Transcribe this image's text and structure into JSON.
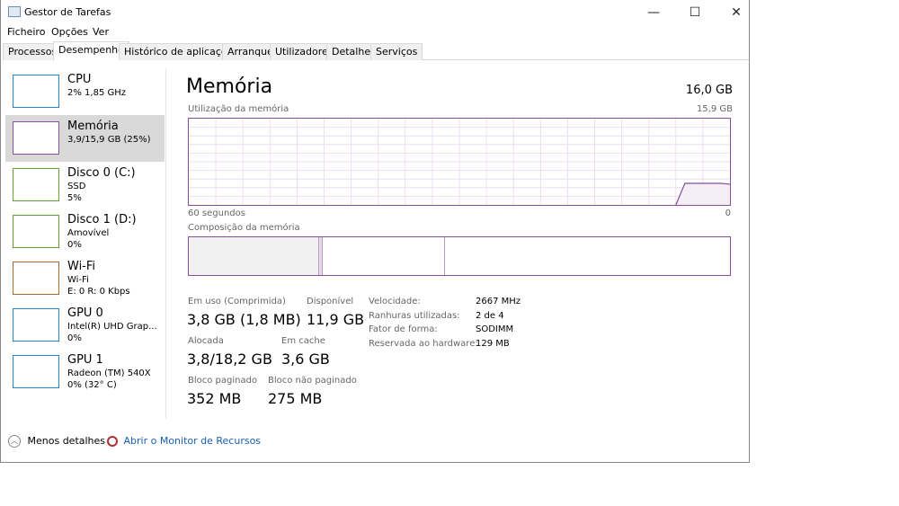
{
  "window": {
    "title": "Gestor de Tarefas",
    "minimize": "—",
    "maximize": "☐",
    "close": "✕"
  },
  "menu": [
    "Ficheiro",
    "Opções",
    "Ver"
  ],
  "tabs": [
    "Processos",
    "Desempenho",
    "Histórico de aplicações",
    "Arranque",
    "Utilizadores",
    "Detalhes",
    "Serviços"
  ],
  "sidebar": [
    {
      "name": "CPU",
      "line1": "2% 1,85 GHz",
      "line2": "",
      "color": "#1e88c8"
    },
    {
      "name": "Memória",
      "line1": "3,9/15,9 GB (25%)",
      "line2": "",
      "color": "#8b4c9e"
    },
    {
      "name": "Disco 0 (C:)",
      "line1": "SSD",
      "line2": "5%",
      "color": "#5fa030"
    },
    {
      "name": "Disco 1 (D:)",
      "line1": "Amovível",
      "line2": "0%",
      "color": "#5fa030"
    },
    {
      "name": "Wi-Fi",
      "line1": "Wi-Fi",
      "line2": "E: 0 R: 0 Kbps",
      "color": "#a86d28"
    },
    {
      "name": "GPU 0",
      "line1": "Intel(R) UHD Grap...",
      "line2": "0%",
      "color": "#1e88c8"
    },
    {
      "name": "GPU 1",
      "line1": "Radeon (TM) 540X",
      "line2": "0% (32° C)",
      "color": "#1e88c8"
    }
  ],
  "main": {
    "title": "Memória",
    "total": "16,0 GB",
    "usage_label": "Utilização da memória",
    "usage_max": "15,9 GB",
    "time_left": "60 segundos",
    "time_right": "0",
    "composition_label": "Composição da memória",
    "usage_series_percent": [
      0,
      0,
      0,
      0,
      0,
      0,
      0,
      0,
      0,
      0,
      0,
      0,
      0,
      0,
      0,
      0,
      0,
      0,
      0,
      0,
      0,
      0,
      0,
      0,
      0,
      0,
      0,
      0,
      0,
      0,
      0,
      0,
      0,
      0,
      0,
      0,
      0,
      0,
      0,
      0,
      0,
      0,
      0,
      0,
      0,
      0,
      0,
      0,
      0,
      0,
      0,
      0,
      0,
      0,
      0,
      25,
      25,
      25,
      25,
      25,
      24
    ],
    "composition": {
      "in_use_gb": 3.8,
      "modified_gb": 0.1,
      "standby_gb": 3.6,
      "free_gb": 8.4
    },
    "stats": [
      {
        "label": "Em uso (Comprimida)",
        "value": "3,8 GB (1,8 MB)"
      },
      {
        "label": "Disponível",
        "value": "11,9 GB"
      },
      {
        "label": "Alocada",
        "value": "3,8/18,2 GB"
      },
      {
        "label": "Em cache",
        "value": "3,6 GB"
      },
      {
        "label": "Bloco paginado",
        "value": "352 MB"
      },
      {
        "label": "Bloco não paginado",
        "value": "275 MB"
      }
    ],
    "props": [
      {
        "k": "Velocidade:",
        "v": "2667 MHz"
      },
      {
        "k": "Ranhuras utilizadas:",
        "v": "2 de 4"
      },
      {
        "k": "Fator de forma:",
        "v": "SODIMM"
      },
      {
        "k": "Reservada ao hardware:",
        "v": "129 MB"
      }
    ]
  },
  "footer": {
    "less": "Menos detalhes",
    "monitor": "Abrir o Monitor de Recursos"
  }
}
